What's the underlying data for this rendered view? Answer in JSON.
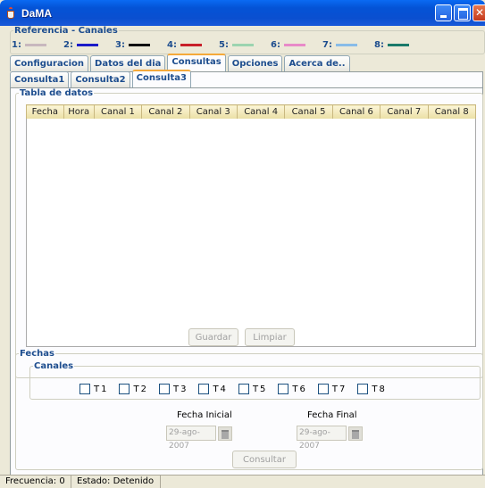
{
  "window": {
    "title": "DaMA"
  },
  "referencia": {
    "legend": "Referencia - Canales",
    "items": [
      {
        "label": "1:",
        "color": "#c8b8be"
      },
      {
        "label": "2:",
        "color": "#1a1ac8"
      },
      {
        "label": "3:",
        "color": "#111111"
      },
      {
        "label": "4:",
        "color": "#c8202a"
      },
      {
        "label": "5:",
        "color": "#9cd4b0"
      },
      {
        "label": "6:",
        "color": "#e88ac8"
      },
      {
        "label": "7:",
        "color": "#88bce8"
      },
      {
        "label": "8:",
        "color": "#1a7a6a"
      }
    ]
  },
  "tabs": [
    "Configuracion",
    "Datos del dia",
    "Consultas",
    "Opciones",
    "Acerca de.."
  ],
  "active_tab": "Consultas",
  "subtabs": [
    "Consulta1",
    "Consulta2",
    "Consulta3"
  ],
  "active_subtab": "Consulta3",
  "tabla": {
    "legend": "Tabla de datos",
    "columns": [
      "Fecha",
      "Hora",
      "Canal 1",
      "Canal 2",
      "Canal 3",
      "Canal 4",
      "Canal 5",
      "Canal 6",
      "Canal 7",
      "Canal 8"
    ],
    "guardar_label": "Guardar",
    "limpiar_label": "Limpiar"
  },
  "fechas": {
    "legend": "Fechas",
    "canales_legend": "Canales",
    "checks": [
      "T1",
      "T2",
      "T3",
      "T4",
      "T5",
      "T6",
      "T7",
      "T8"
    ],
    "fecha_inicial_label": "Fecha Inicial",
    "fecha_final_label": "Fecha Final",
    "fecha_inicial": "29-ago-2007",
    "fecha_final": "29-ago-2007",
    "consultar_label": "Consultar"
  },
  "status": {
    "frecuencia": "Frecuencia: 0",
    "estado": "Estado: Detenido"
  }
}
